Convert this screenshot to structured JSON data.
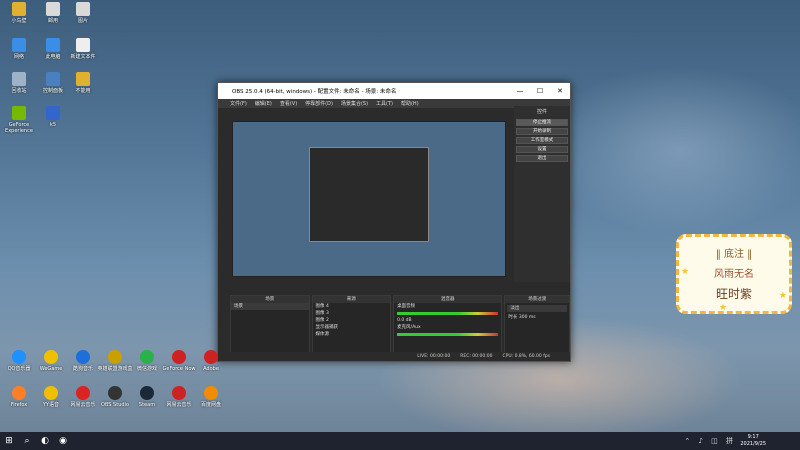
{
  "desktop_icons": [
    {
      "label": "小鸟壁",
      "color": "#e0b030"
    },
    {
      "label": "邮用",
      "color": "#d9d9d9"
    },
    {
      "label": "图片",
      "color": "#d9d9d9"
    },
    {
      "label": "网络",
      "color": "#3a8ee6"
    },
    {
      "label": "此电脑",
      "color": "#3a8ee6"
    },
    {
      "label": "新建文本件",
      "color": "#eeeeee"
    },
    {
      "label": "回收站",
      "color": "#9fb3c8"
    },
    {
      "label": "控制面板",
      "color": "#4a7fc1"
    },
    {
      "label": "不能用",
      "color": "#e0b030"
    },
    {
      "label": "GeForce Experience",
      "color": "#76b900"
    },
    {
      "label": "k5",
      "color": "#3366cc"
    }
  ],
  "bottom_icons": [
    {
      "label": "QQ音乐器",
      "color": "#1e90ff"
    },
    {
      "label": "WeGame",
      "color": "#f0c000"
    },
    {
      "label": "酷狗音乐",
      "color": "#1e6fd9"
    },
    {
      "label": "英雄联盟游戏盒",
      "color": "#c9a000"
    },
    {
      "label": "微信游戏",
      "color": "#2ab14a"
    },
    {
      "label": "GeForce Now",
      "color": "#cc2222"
    },
    {
      "label": "Adobe",
      "color": "#cc2222"
    },
    {
      "label": "Firefox",
      "color": "#ff7f27"
    },
    {
      "label": "YY语音",
      "color": "#f0c000"
    },
    {
      "label": "网易云音乐",
      "color": "#d22"
    },
    {
      "label": "OBS Studio",
      "color": "#333"
    },
    {
      "label": "Steam",
      "color": "#1b2838"
    },
    {
      "label": "网易云音乐",
      "color": "#c22"
    },
    {
      "label": "百度网盘",
      "color": "#f08c00"
    }
  ],
  "obs": {
    "title": "OBS 25.0.4 (64-bit, windows) - 配置文件: 未命名 - 场景: 未命名",
    "minimize": "—",
    "maximize": "☐",
    "close": "✕",
    "menu": [
      "文件(F)",
      "编辑(E)",
      "查看(V)",
      "停靠部件(D)",
      "场景集合(S)",
      "工具(T)",
      "帮助(H)"
    ],
    "controls_header": "控件",
    "controls": [
      "停止推流",
      "开始录制",
      "工作室模式",
      "设置",
      "退出"
    ],
    "docks": {
      "scenes": {
        "title": "场景",
        "items": [
          "场景"
        ]
      },
      "sources": {
        "title": "来源",
        "items": [
          "图像 4",
          "图像 3",
          "图像 2",
          "显示器捕获",
          "媒体源"
        ]
      },
      "mixer": {
        "title": "混音器",
        "tracks": [
          "桌面音频",
          "麦克风/Aux"
        ],
        "level": "0.0 dB"
      },
      "transitions": {
        "title": "场景过渡",
        "type": "淡出",
        "duration_label": "时长",
        "duration": "300 ms"
      }
    },
    "status": {
      "live": "LIVE: 00:00:00",
      "rec": "REC: 00:00:00",
      "cpu": "CPU: 0.8%, 60.00 fps"
    }
  },
  "sticker": {
    "line1": "‖ 底注 ‖",
    "line2": "风雨无名",
    "line3": "旺时紫"
  },
  "taskbar": {
    "start_icon": "windows-icon",
    "clock_time": "9:17",
    "clock_date": "2021/9/25"
  }
}
